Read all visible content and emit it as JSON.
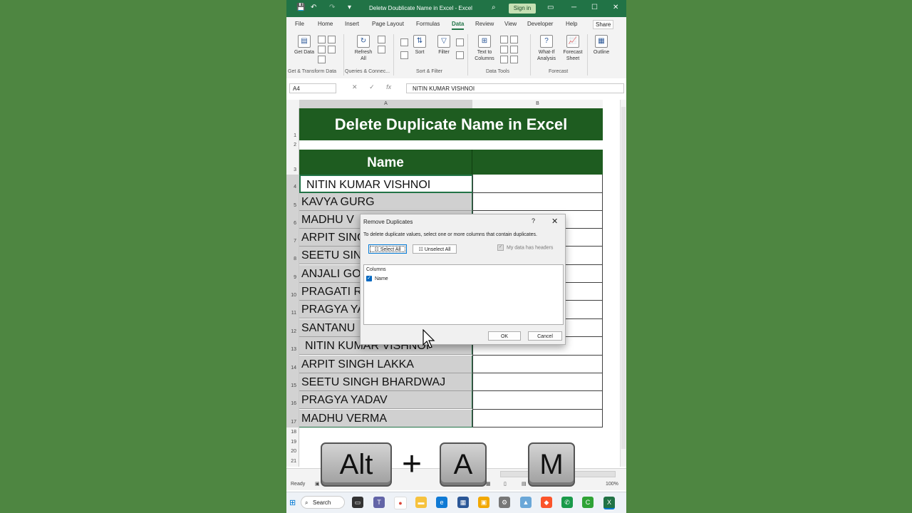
{
  "window": {
    "title": "Deletw Doublicate Name in Excel  -  Excel",
    "sign_in": "Sign in",
    "share": "Share"
  },
  "tabs": [
    "File",
    "Home",
    "Insert",
    "Page Layout",
    "Formulas",
    "Data",
    "Review",
    "View",
    "Developer",
    "Help"
  ],
  "active_tab": "Data",
  "ribbon": {
    "get_data": "Get Data",
    "refresh_all": "Refresh All",
    "sort": "Sort",
    "filter": "Filter",
    "text_to_columns": "Text to Columns",
    "what_if": "What-If Analysis",
    "forecast_sheet": "Forecast Sheet",
    "outline": "Outline",
    "groups": [
      "Get & Transform Data",
      "Queries & Connec...",
      "Sort & Filter",
      "Data Tools",
      "Forecast"
    ]
  },
  "formula_bar": {
    "name_box": "A4",
    "fx": "fx",
    "value": "NITIN KUMAR VISHNOI"
  },
  "columns": [
    "A",
    "B"
  ],
  "rows": [
    "1",
    "2",
    "3",
    "4",
    "5",
    "6",
    "7",
    "8",
    "9",
    "10",
    "11",
    "12",
    "13",
    "14",
    "15",
    "16",
    "17",
    "18",
    "19",
    "20",
    "21"
  ],
  "sheet": {
    "title": "Delete Duplicate Name in Excel",
    "header": "Name",
    "names": [
      "NITIN KUMAR VISHNOI",
      "KAVYA GURG",
      "MADHU V",
      "ARPIT SINGH",
      "SEETU SIN",
      "ANJALI GO",
      "PRAGATI R",
      "PRAGYA YA",
      "SANTANU",
      "NITIN KUMAR VISHNOI",
      "ARPIT SINGH LAKKA",
      "SEETU SINGH BHARDWAJ",
      "PRAGYA YADAV",
      "MADHU VERMA"
    ]
  },
  "dialog": {
    "title": "Remove Duplicates",
    "help": "?",
    "close": "✕",
    "description": "To delete duplicate values, select one or more columns that contain duplicates.",
    "select_all": "Select All",
    "unselect_all": "Unselect All",
    "headers_checkbox": "My data has headers",
    "columns_label": "Columns",
    "column_item": "Name",
    "ok": "OK",
    "cancel": "Cancel"
  },
  "keys": {
    "alt": "Alt",
    "plus": "+",
    "a": "A",
    "m": "M"
  },
  "status": {
    "ready": "Ready",
    "zoom": "100%"
  },
  "taskbar": {
    "search": "Search"
  }
}
